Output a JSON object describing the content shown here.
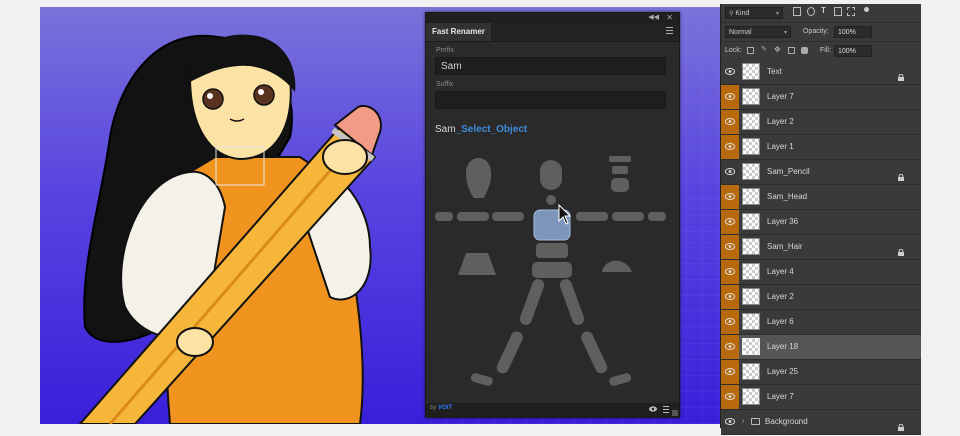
{
  "panel": {
    "title": "Fast Renamer",
    "prefix_label": "Prefix",
    "prefix_value": "Sam",
    "suffix_label": "Suffix",
    "suffix_value": "",
    "preview_prefix": "Sam",
    "preview_name": "_Select_Object",
    "footer_by": "by",
    "footer_brand": "VOIT"
  },
  "layers_panel": {
    "kind_label": "Kind",
    "blend_mode": "Normal",
    "opacity_label": "Opacity:",
    "opacity_value": "100%",
    "lock_label": "Lock:",
    "fill_label": "Fill:",
    "fill_value": "100%",
    "layers": [
      {
        "name": "Text",
        "orange": false,
        "locked": true,
        "selected": false
      },
      {
        "name": "Layer 7",
        "orange": true,
        "locked": false,
        "selected": false
      },
      {
        "name": "Layer 2",
        "orange": true,
        "locked": false,
        "selected": false
      },
      {
        "name": "Layer 1",
        "orange": true,
        "locked": false,
        "selected": false
      },
      {
        "name": "Sam_Pencil",
        "orange": false,
        "locked": true,
        "selected": false
      },
      {
        "name": "Sam_Head",
        "orange": true,
        "locked": false,
        "selected": false
      },
      {
        "name": "Layer 36",
        "orange": true,
        "locked": false,
        "selected": false
      },
      {
        "name": "Sam_Hair",
        "orange": true,
        "locked": true,
        "selected": false
      },
      {
        "name": "Layer 4",
        "orange": true,
        "locked": false,
        "selected": false
      },
      {
        "name": "Layer 2",
        "orange": true,
        "locked": false,
        "selected": false
      },
      {
        "name": "Layer 6",
        "orange": true,
        "locked": false,
        "selected": false
      },
      {
        "name": "Layer 18",
        "orange": true,
        "locked": false,
        "selected": true
      },
      {
        "name": "Layer 25",
        "orange": true,
        "locked": false,
        "selected": false
      },
      {
        "name": "Layer 7",
        "orange": true,
        "locked": false,
        "selected": false
      },
      {
        "name": "Background",
        "orange": false,
        "locked": true,
        "selected": false,
        "folder": true
      }
    ]
  },
  "colors": {
    "accent_blue": "#3d8ddb",
    "layer_orange": "#b8690b",
    "canvas_purple": "#4a33dc",
    "character_orange": "#f0941f"
  }
}
